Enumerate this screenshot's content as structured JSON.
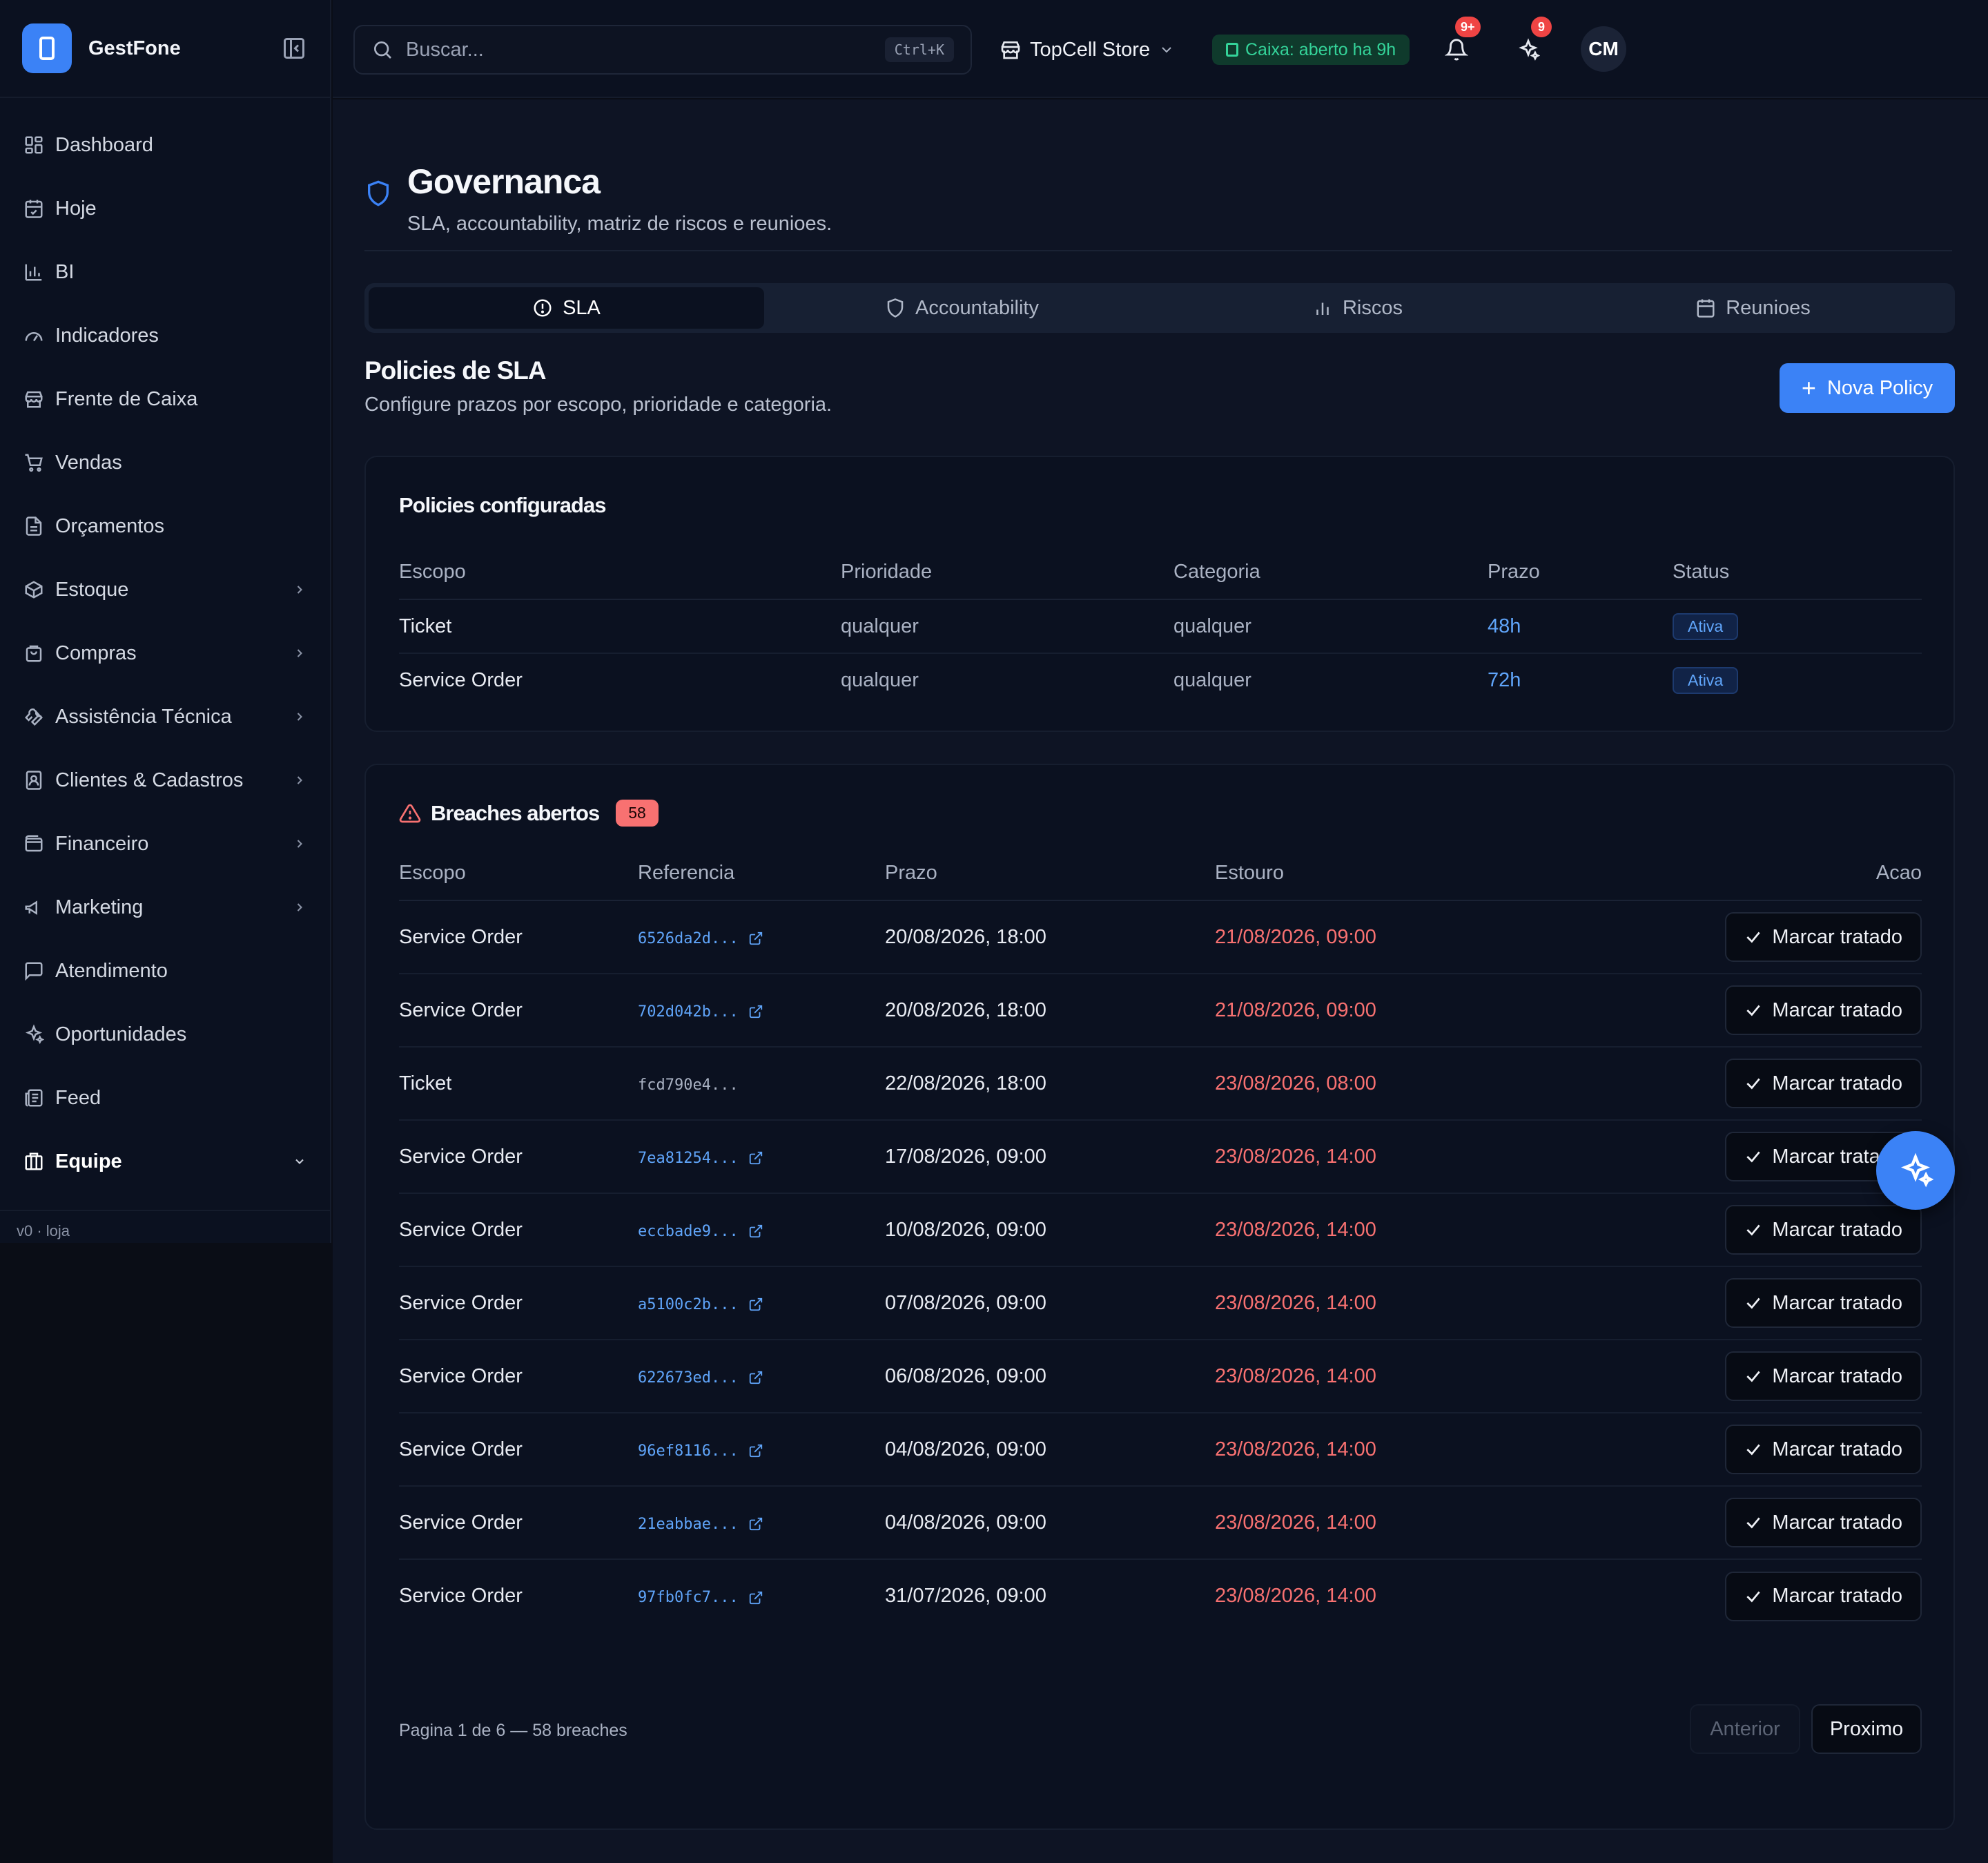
{
  "sidebar": {
    "brand": "GestFone",
    "items": [
      {
        "label": "Dashboard"
      },
      {
        "label": "Hoje"
      },
      {
        "label": "BI"
      },
      {
        "label": "Indicadores"
      },
      {
        "label": "Frente de Caixa"
      },
      {
        "label": "Vendas"
      },
      {
        "label": "Orçamentos"
      },
      {
        "label": "Estoque"
      },
      {
        "label": "Compras"
      },
      {
        "label": "Assistência Técnica"
      },
      {
        "label": "Clientes & Cadastros"
      },
      {
        "label": "Financeiro"
      },
      {
        "label": "Marketing"
      },
      {
        "label": "Atendimento"
      },
      {
        "label": "Oportunidades"
      },
      {
        "label": "Feed"
      },
      {
        "label": "Equipe"
      }
    ],
    "footer": "v0 · loja"
  },
  "topbar": {
    "search_placeholder": "Buscar...",
    "shortcut": "Ctrl+K",
    "store": "TopCell Store",
    "caixa": "Caixa: aberto ha 9h",
    "notifications_badge": "9+",
    "ai_badge": "9",
    "avatar": "CM"
  },
  "page": {
    "title": "Governanca",
    "subtitle": "SLA, accountability, matriz de riscos e reunioes."
  },
  "tabs": [
    {
      "label": "SLA"
    },
    {
      "label": "Accountability"
    },
    {
      "label": "Riscos"
    },
    {
      "label": "Reunioes"
    }
  ],
  "section": {
    "title": "Policies de SLA",
    "subtitle": "Configure prazos por escopo, prioridade e categoria.",
    "new_button": "Nova Policy"
  },
  "policies": {
    "title": "Policies configuradas",
    "headers": [
      "Escopo",
      "Prioridade",
      "Categoria",
      "Prazo",
      "Status"
    ],
    "rows": [
      {
        "escopo": "Ticket",
        "prioridade": "qualquer",
        "categoria": "qualquer",
        "prazo": "48h",
        "status": "Ativa"
      },
      {
        "escopo": "Service Order",
        "prioridade": "qualquer",
        "categoria": "qualquer",
        "prazo": "72h",
        "status": "Ativa"
      }
    ]
  },
  "breaches": {
    "title": "Breaches abertos",
    "count": "58",
    "headers": [
      "Escopo",
      "Referencia",
      "Prazo",
      "Estouro",
      "Acao"
    ],
    "action_label": "Marcar tratado",
    "rows": [
      {
        "escopo": "Service Order",
        "ref": "6526da2d...",
        "link": true,
        "prazo": "20/08/2026, 18:00",
        "estouro": "21/08/2026, 09:00"
      },
      {
        "escopo": "Service Order",
        "ref": "702d042b...",
        "link": true,
        "prazo": "20/08/2026, 18:00",
        "estouro": "21/08/2026, 09:00"
      },
      {
        "escopo": "Ticket",
        "ref": "fcd790e4...",
        "link": false,
        "prazo": "22/08/2026, 18:00",
        "estouro": "23/08/2026, 08:00"
      },
      {
        "escopo": "Service Order",
        "ref": "7ea81254...",
        "link": true,
        "prazo": "17/08/2026, 09:00",
        "estouro": "23/08/2026, 14:00"
      },
      {
        "escopo": "Service Order",
        "ref": "eccbade9...",
        "link": true,
        "prazo": "10/08/2026, 09:00",
        "estouro": "23/08/2026, 14:00"
      },
      {
        "escopo": "Service Order",
        "ref": "a5100c2b...",
        "link": true,
        "prazo": "07/08/2026, 09:00",
        "estouro": "23/08/2026, 14:00"
      },
      {
        "escopo": "Service Order",
        "ref": "622673ed...",
        "link": true,
        "prazo": "06/08/2026, 09:00",
        "estouro": "23/08/2026, 14:00"
      },
      {
        "escopo": "Service Order",
        "ref": "96ef8116...",
        "link": true,
        "prazo": "04/08/2026, 09:00",
        "estouro": "23/08/2026, 14:00"
      },
      {
        "escopo": "Service Order",
        "ref": "21eabbae...",
        "link": true,
        "prazo": "04/08/2026, 09:00",
        "estouro": "23/08/2026, 14:00"
      },
      {
        "escopo": "Service Order",
        "ref": "97fb0fc7...",
        "link": true,
        "prazo": "31/07/2026, 09:00",
        "estouro": "23/08/2026, 14:00"
      }
    ],
    "pager_text": "Pagina 1 de 6 — 58 breaches",
    "prev_label": "Anterior",
    "next_label": "Proximo"
  },
  "colors": {
    "accent": "#3b82f6",
    "danger": "#f87171",
    "success": "#34d399"
  }
}
